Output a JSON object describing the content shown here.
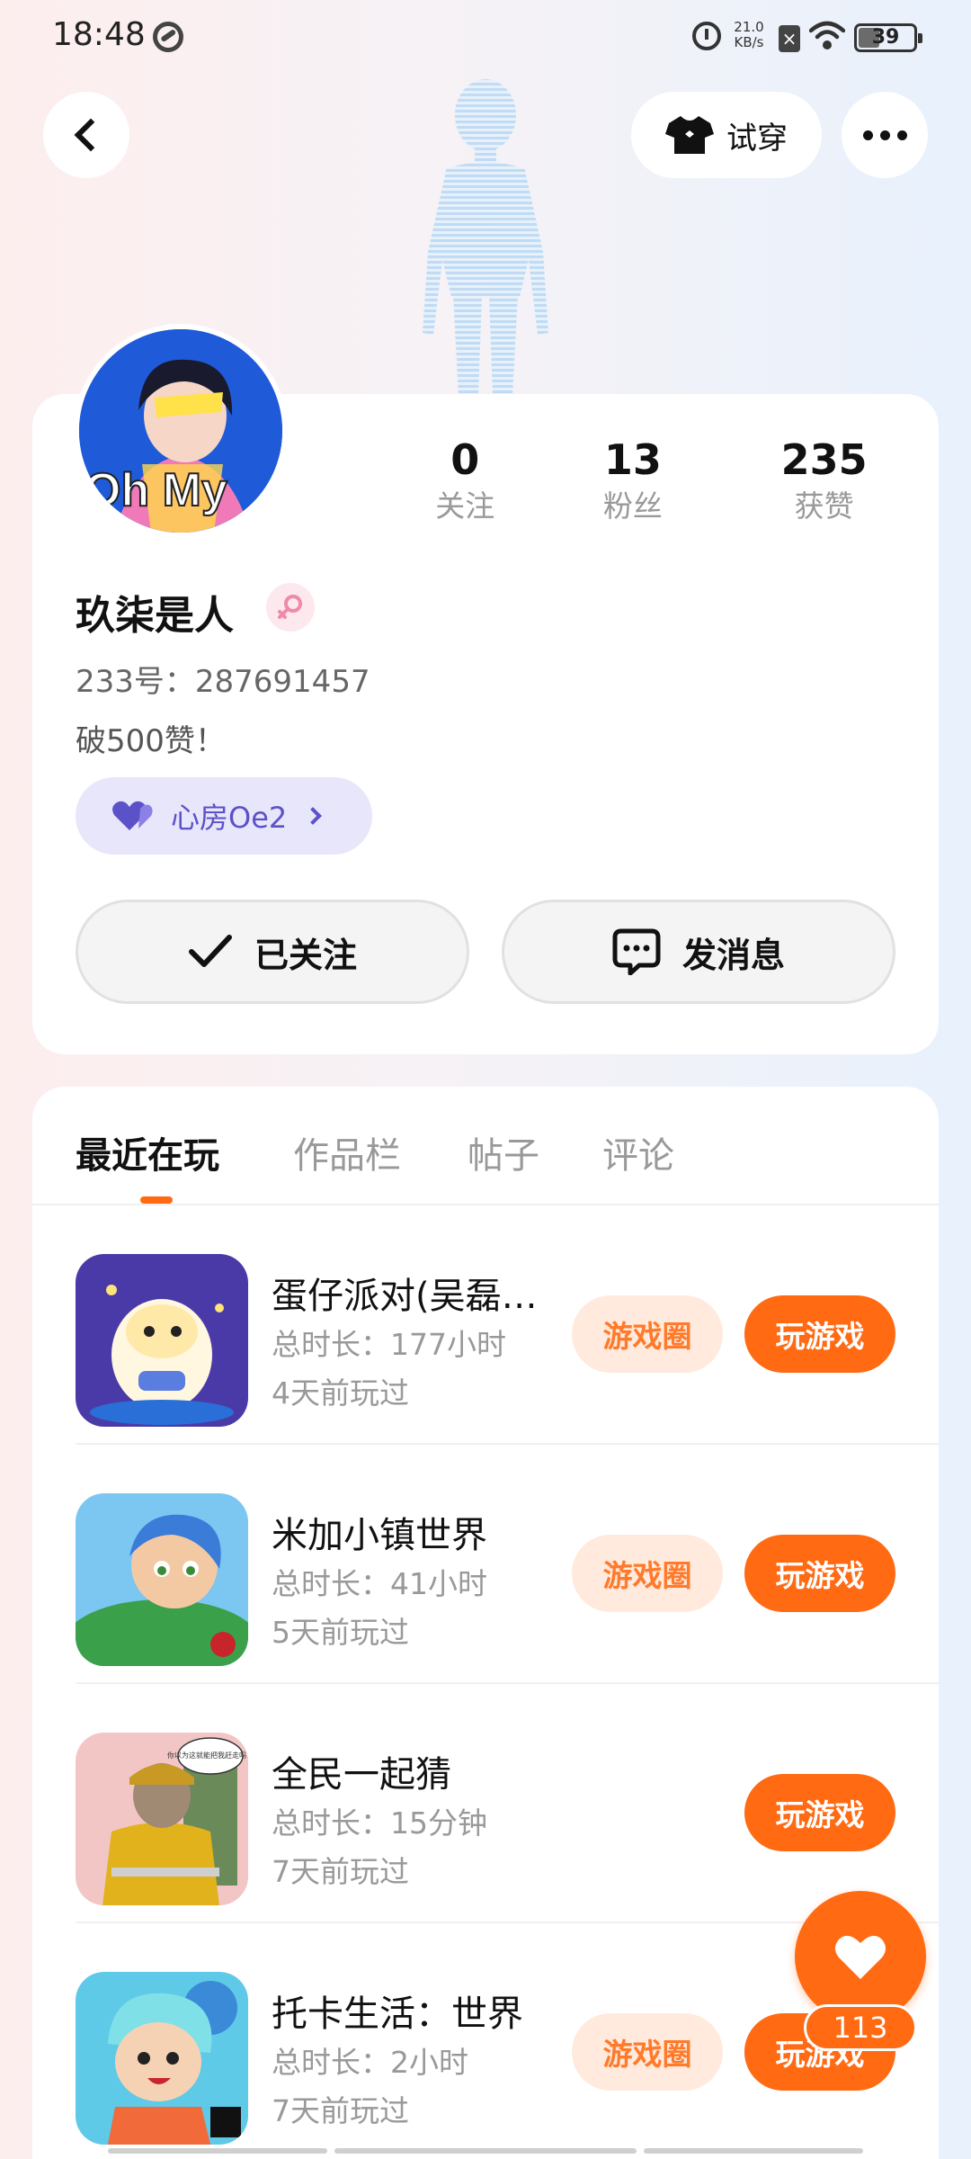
{
  "status_bar": {
    "time": "18:48",
    "net_speed_value": "21.0",
    "net_speed_unit": "KB/s",
    "battery_level": "39",
    "battery_fraction": 0.39
  },
  "header": {
    "tryon_label": "试穿"
  },
  "profile": {
    "username": "玖柒是人",
    "id_line": "233号：287691457",
    "bio": "破500赞！",
    "avatar_text": "Oh My",
    "room_label": "心房Oe2",
    "stats": [
      {
        "value": "0",
        "label": "关注"
      },
      {
        "value": "13",
        "label": "粉丝"
      },
      {
        "value": "235",
        "label": "获赞"
      }
    ],
    "follow_label": "已关注",
    "message_label": "发消息"
  },
  "tabs": [
    {
      "label": "最近在玩"
    },
    {
      "label": "作品栏"
    },
    {
      "label": "帖子"
    },
    {
      "label": "评论"
    }
  ],
  "games": [
    {
      "title": "蛋仔派对(吴磊代言)",
      "duration": "总时长：177小时",
      "last_played": "4天前玩过",
      "circle_label": "游戏圈",
      "play_label": "玩游戏"
    },
    {
      "title": "米加小镇世界",
      "duration": "总时长：41小时",
      "last_played": "5天前玩过",
      "circle_label": "游戏圈",
      "play_label": "玩游戏"
    },
    {
      "title": "全民一起猜",
      "duration": "总时长：15分钟",
      "last_played": "7天前玩过",
      "play_label": "玩游戏",
      "bubble_text": "你以为这就能把我赶走吗？"
    },
    {
      "title": "托卡生活：世界",
      "duration": "总时长：2小时",
      "last_played": "7天前玩过",
      "circle_label": "游戏圈",
      "play_label": "玩游戏"
    }
  ],
  "like": {
    "count": "113"
  },
  "colors": {
    "accent": "#ff6a13",
    "accent_soft": "#ffeadd",
    "room_purple": "#5b51c9"
  }
}
